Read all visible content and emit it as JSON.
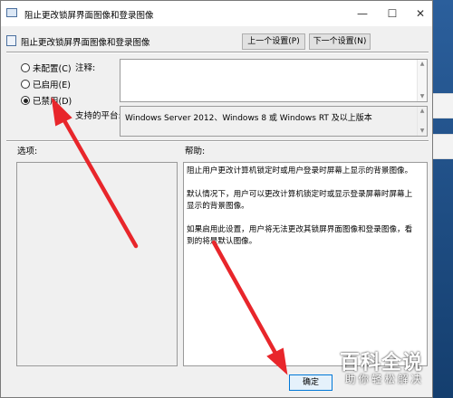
{
  "window": {
    "title": "阻止更改锁屏界面图像和登录图像",
    "controls": {
      "minimize": "—",
      "maximize": "☐",
      "close": "✕"
    }
  },
  "header": {
    "policy_name": "阻止更改锁屏界面图像和登录图像",
    "prev_button": "上一个设置(P)",
    "next_button": "下一个设置(N)"
  },
  "state": {
    "options": [
      {
        "label": "未配置(C)",
        "selected": false
      },
      {
        "label": "已启用(E)",
        "selected": false
      },
      {
        "label": "已禁用(D)",
        "selected": true
      }
    ]
  },
  "comment": {
    "label": "注释:",
    "value": ""
  },
  "platform": {
    "label": "支持的平台:",
    "value": "Windows Server 2012、Windows 8 或 Windows RT 及以上版本"
  },
  "options_section": {
    "label": "选项:"
  },
  "help_section": {
    "label": "帮助:",
    "paragraphs": [
      "阻止用户更改计算机锁定时或用户登录时屏幕上显示的背景图像。",
      "默认情况下，用户可以更改计算机锁定时或显示登录屏幕时屏幕上显示的背景图像。",
      "如果启用此设置，用户将无法更改其锁屏界面图像和登录图像，看到的将是默认图像。"
    ]
  },
  "footer": {
    "ok_button": "确定"
  },
  "watermark": {
    "line1": "百科全说",
    "line2": "助你轻松解决"
  },
  "annotation": {
    "arrow_color": "#e8262b"
  }
}
